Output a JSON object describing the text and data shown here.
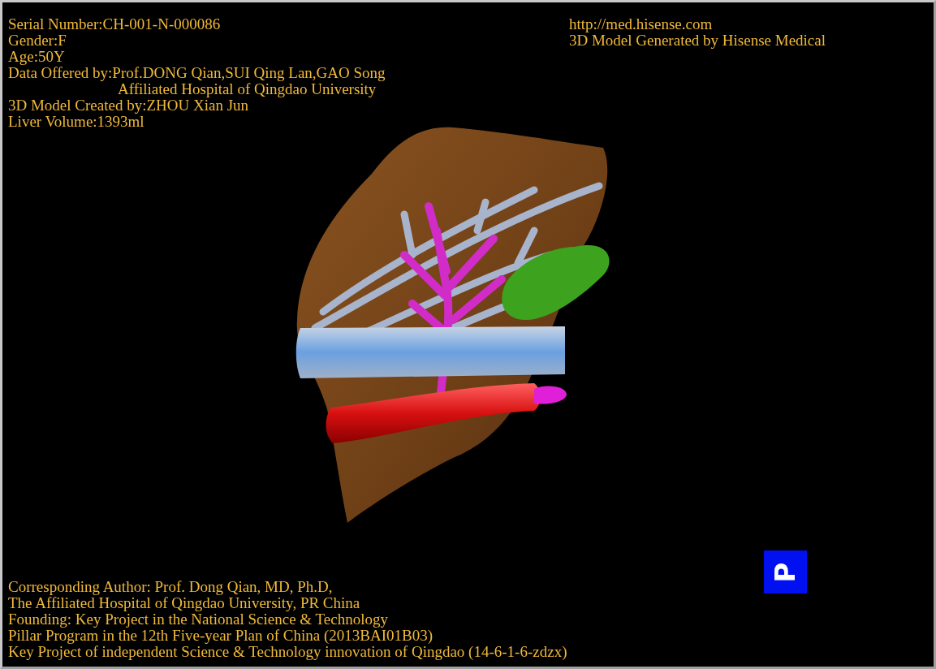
{
  "patient_info": [
    {
      "kind": "line",
      "text": "Serial Number:CH-001-N-000086"
    },
    {
      "kind": "line",
      "text": "Gender:F"
    },
    {
      "kind": "line",
      "text": "Age:50Y"
    },
    {
      "kind": "line",
      "text": "Data Offered by:Prof.DONG Qian,SUI Qing Lan,GAO Song"
    },
    {
      "kind": "continuation",
      "text": "Affiliated Hospital of Qingdao University"
    },
    {
      "kind": "line",
      "text": "3D Model Created by:ZHOU Xian Jun"
    },
    {
      "kind": "line",
      "text": "Liver Volume:1393ml"
    }
  ],
  "source_info": [
    "http://med.hisense.com",
    "3D Model Generated by Hisense Medical"
  ],
  "credits": [
    "Corresponding Author: Prof. Dong Qian, MD, Ph.D,",
    "The Affiliated Hospital of Qingdao University, PR China",
    "Founding: Key Project in the National Science & Technology",
    "Pillar Program in the 12th Five-year Plan of China (2013BAI01B03)",
    "Key Project of independent Science & Technology innovation of Qingdao (14-6-1-6-zdzx)"
  ],
  "orientation_marker": {
    "label": "P"
  }
}
